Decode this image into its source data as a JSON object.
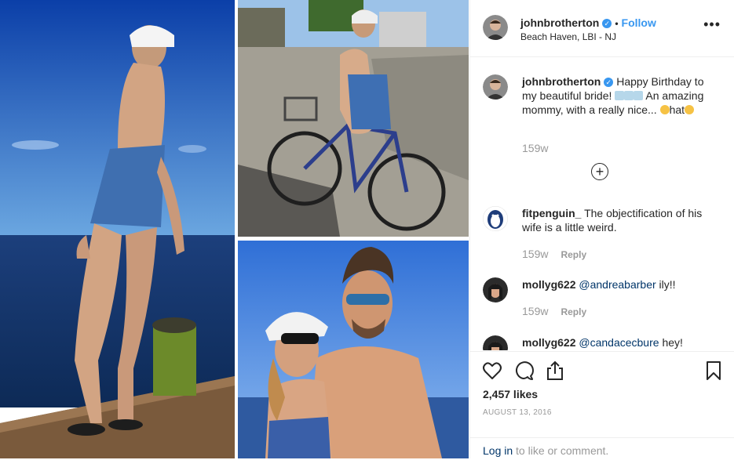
{
  "header": {
    "username": "johnbrotherton",
    "separator": "•",
    "follow_label": "Follow",
    "location": "Beach Haven, LBI - NJ",
    "more_icon": "more-options-icon",
    "more_glyph": "•••"
  },
  "caption": {
    "username": "johnbrotherton",
    "text_before": "Happy Birthday to my beautiful bride!",
    "text_middle": "An amazing mommy, with a really nice...",
    "text_after": "hat",
    "time": "159w"
  },
  "comments": [
    {
      "username": "fitpenguin_",
      "mention": "",
      "text": "The objectification of his wife is a little weird.",
      "time": "159w",
      "reply_label": "Reply"
    },
    {
      "username": "mollyg622",
      "mention": "@andreabarber",
      "text": "ily!!",
      "time": "159w",
      "reply_label": "Reply"
    },
    {
      "username": "mollyg622",
      "mention": "@candacecbure",
      "text": "hey!",
      "time": "",
      "reply_label": ""
    }
  ],
  "load_more_glyph": "+",
  "actions": {
    "like_icon": "heart-icon",
    "comment_icon": "comment-icon",
    "share_icon": "share-icon",
    "save_icon": "bookmark-icon",
    "likes": "2,457 likes",
    "date": "AUGUST 13, 2016"
  },
  "login": {
    "link": "Log in",
    "text": " to like or comment."
  },
  "colors": {
    "accent": "#3897f0",
    "secondary_text": "#999999",
    "link": "#003569"
  }
}
